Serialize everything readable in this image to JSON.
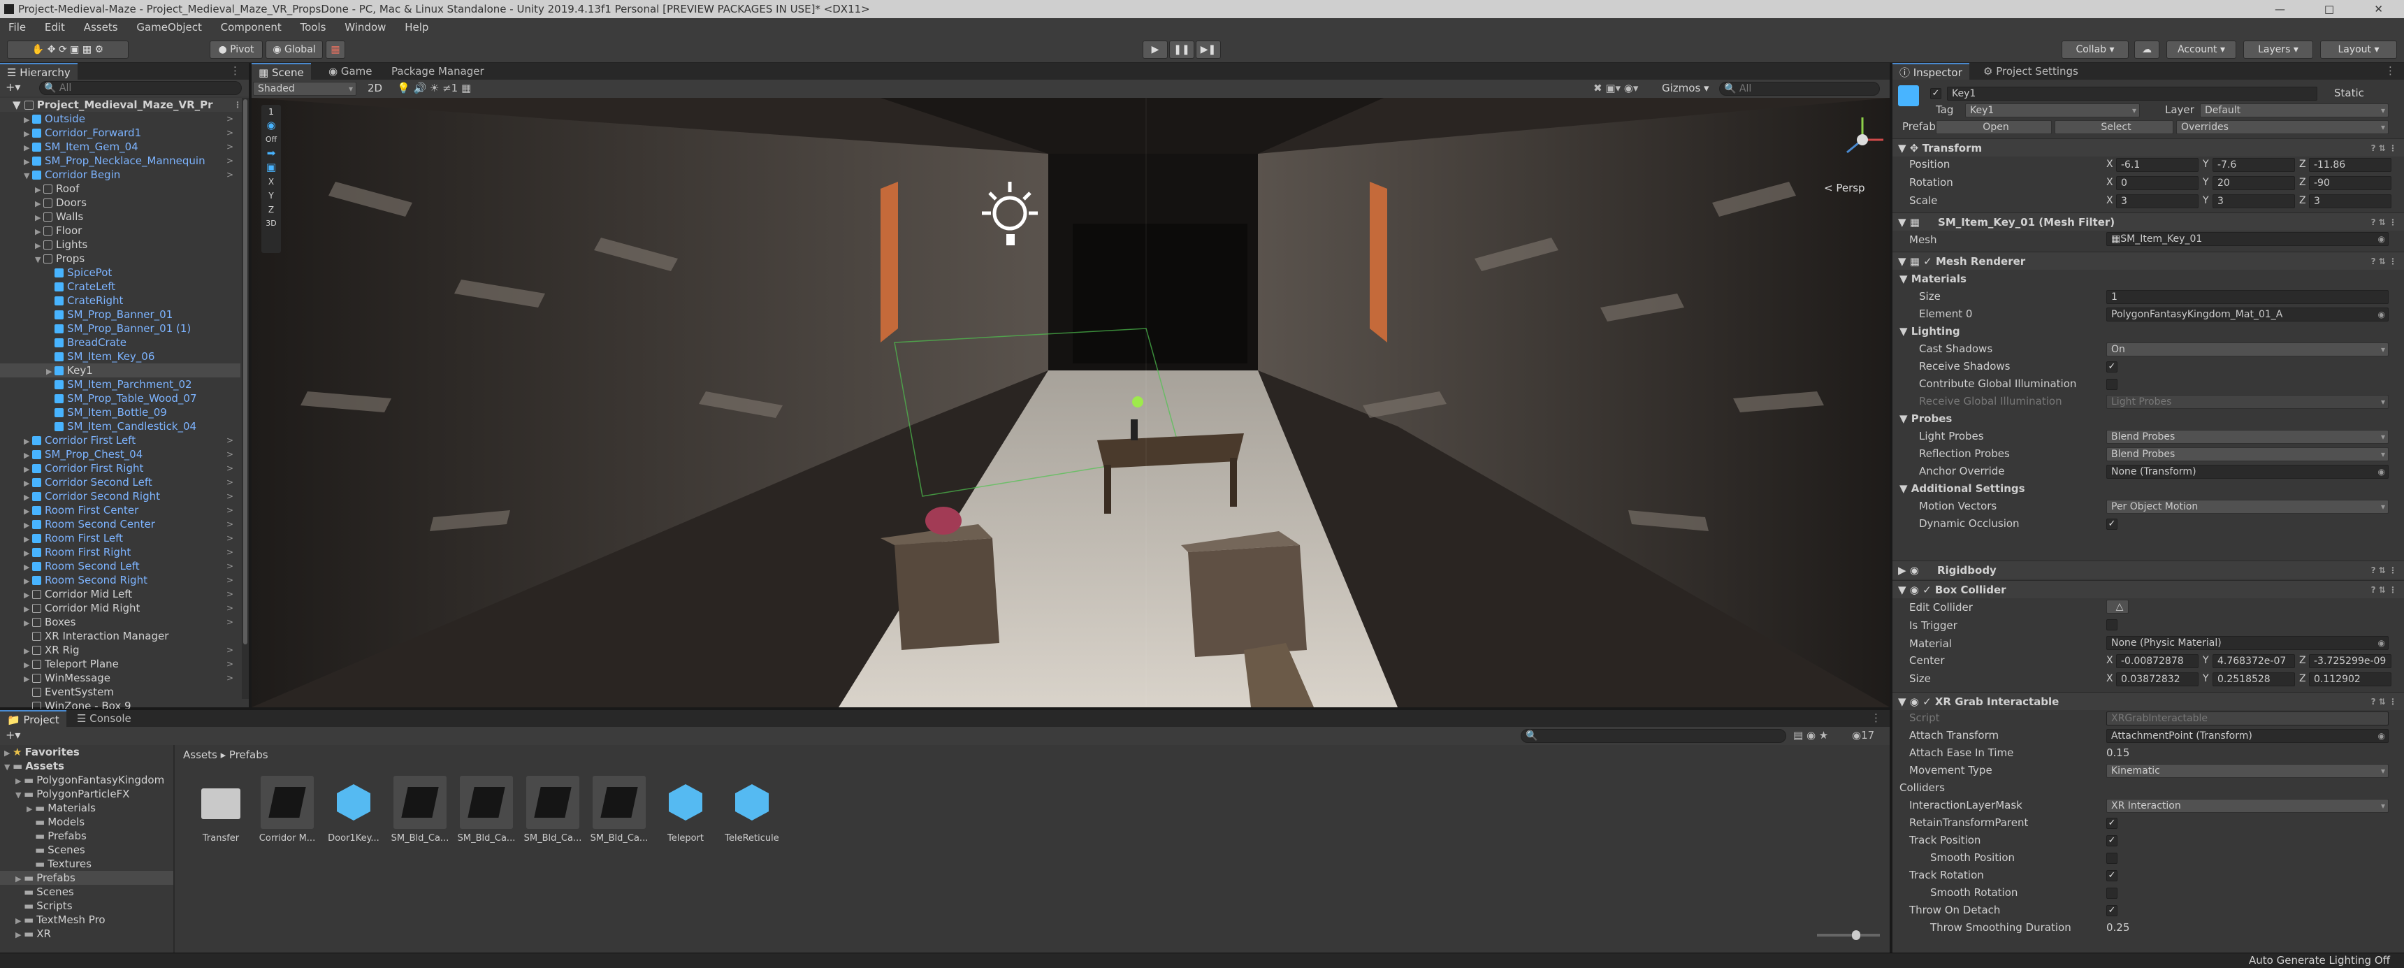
{
  "window_title": "Project-Medieval-Maze - Project_Medieval_Maze_VR_PropsDone - PC, Mac & Linux Standalone - Unity 2019.4.13f1 Personal [PREVIEW PACKAGES IN USE]* <DX11>",
  "menu": [
    "File",
    "Edit",
    "Assets",
    "GameObject",
    "Component",
    "Tools",
    "Window",
    "Help"
  ],
  "toolbar": {
    "pivot": "Pivot",
    "global": "Global",
    "collab": "Collab",
    "account": "Account",
    "layers": "Layers",
    "layout": "Layout"
  },
  "hierarchy": {
    "tab": "Hierarchy",
    "search_placeholder": "All",
    "root": "Project_Medieval_Maze_VR_Pr",
    "items": [
      {
        "label": "Outside",
        "indent": 1,
        "blue": true,
        "cube": "blue",
        "arrow": "▶",
        "sel": false
      },
      {
        "label": "Corridor_Forward1",
        "indent": 1,
        "blue": true,
        "cube": "blue",
        "arrow": "▶",
        "sel": false
      },
      {
        "label": "SM_Item_Gem_04",
        "indent": 1,
        "blue": true,
        "cube": "blue",
        "arrow": "▶",
        "sel": false
      },
      {
        "label": "SM_Prop_Necklace_Mannequin",
        "indent": 1,
        "blue": true,
        "cube": "blue",
        "arrow": "▶",
        "sel": false
      },
      {
        "label": "Corridor Begin",
        "indent": 1,
        "blue": true,
        "cube": "blue",
        "arrow": "▼",
        "sel": false
      },
      {
        "label": "Roof",
        "indent": 2,
        "blue": false,
        "cube": "grey",
        "arrow": "▶",
        "sel": false
      },
      {
        "label": "Doors",
        "indent": 2,
        "blue": false,
        "cube": "grey",
        "arrow": "▶",
        "sel": false
      },
      {
        "label": "Walls",
        "indent": 2,
        "blue": false,
        "cube": "grey",
        "arrow": "▶",
        "sel": false
      },
      {
        "label": "Floor",
        "indent": 2,
        "blue": false,
        "cube": "grey",
        "arrow": "▶",
        "sel": false
      },
      {
        "label": "Lights",
        "indent": 2,
        "blue": false,
        "cube": "grey",
        "arrow": "▶",
        "sel": false
      },
      {
        "label": "Props",
        "indent": 2,
        "blue": false,
        "cube": "grey",
        "arrow": "▼",
        "sel": false
      },
      {
        "label": "SpicePot",
        "indent": 3,
        "blue": true,
        "cube": "blue",
        "arrow": "",
        "sel": false
      },
      {
        "label": "CrateLeft",
        "indent": 3,
        "blue": true,
        "cube": "blue",
        "arrow": "",
        "sel": false
      },
      {
        "label": "CrateRight",
        "indent": 3,
        "blue": true,
        "cube": "blue",
        "arrow": "",
        "sel": false
      },
      {
        "label": "SM_Prop_Banner_01",
        "indent": 3,
        "blue": true,
        "cube": "blue",
        "arrow": "",
        "sel": false
      },
      {
        "label": "SM_Prop_Banner_01 (1)",
        "indent": 3,
        "blue": true,
        "cube": "blue",
        "arrow": "",
        "sel": false
      },
      {
        "label": "BreadCrate",
        "indent": 3,
        "blue": true,
        "cube": "blue",
        "arrow": "",
        "sel": false
      },
      {
        "label": "SM_Item_Key_06",
        "indent": 3,
        "blue": true,
        "cube": "blue",
        "arrow": "",
        "sel": false
      },
      {
        "label": "Key1",
        "indent": 3,
        "blue": false,
        "cube": "blue",
        "arrow": "▶",
        "sel": true
      },
      {
        "label": "SM_Item_Parchment_02",
        "indent": 3,
        "blue": true,
        "cube": "blue",
        "arrow": "",
        "sel": false
      },
      {
        "label": "SM_Prop_Table_Wood_07",
        "indent": 3,
        "blue": true,
        "cube": "blue",
        "arrow": "",
        "sel": false
      },
      {
        "label": "SM_Item_Bottle_09",
        "indent": 3,
        "blue": true,
        "cube": "blue",
        "arrow": "",
        "sel": false
      },
      {
        "label": "SM_Item_Candlestick_04",
        "indent": 3,
        "blue": true,
        "cube": "blue",
        "arrow": "",
        "sel": false
      },
      {
        "label": "Corridor First Left",
        "indent": 1,
        "blue": true,
        "cube": "blue",
        "arrow": "▶",
        "sel": false
      },
      {
        "label": "SM_Prop_Chest_04",
        "indent": 1,
        "blue": true,
        "cube": "blue",
        "arrow": "▶",
        "sel": false
      },
      {
        "label": "Corridor First Right",
        "indent": 1,
        "blue": true,
        "cube": "blue",
        "arrow": "▶",
        "sel": false
      },
      {
        "label": "Corridor Second Left",
        "indent": 1,
        "blue": true,
        "cube": "blue",
        "arrow": "▶",
        "sel": false
      },
      {
        "label": "Corridor Second Right",
        "indent": 1,
        "blue": true,
        "cube": "blue",
        "arrow": "▶",
        "sel": false
      },
      {
        "label": "Room First Center",
        "indent": 1,
        "blue": true,
        "cube": "blue",
        "arrow": "▶",
        "sel": false
      },
      {
        "label": "Room Second Center",
        "indent": 1,
        "blue": true,
        "cube": "blue",
        "arrow": "▶",
        "sel": false
      },
      {
        "label": "Room First Left",
        "indent": 1,
        "blue": true,
        "cube": "blue",
        "arrow": "▶",
        "sel": false
      },
      {
        "label": "Room First Right",
        "indent": 1,
        "blue": true,
        "cube": "blue",
        "arrow": "▶",
        "sel": false
      },
      {
        "label": "Room Second Left",
        "indent": 1,
        "blue": true,
        "cube": "blue",
        "arrow": "▶",
        "sel": false
      },
      {
        "label": "Room Second Right",
        "indent": 1,
        "blue": true,
        "cube": "blue",
        "arrow": "▶",
        "sel": false
      },
      {
        "label": "Corridor Mid Left",
        "indent": 1,
        "blue": false,
        "cube": "grey",
        "arrow": "▶",
        "sel": false
      },
      {
        "label": "Corridor Mid Right",
        "indent": 1,
        "blue": false,
        "cube": "grey",
        "arrow": "▶",
        "sel": false
      },
      {
        "label": "Boxes",
        "indent": 1,
        "blue": false,
        "cube": "grey",
        "arrow": "▶",
        "sel": false
      },
      {
        "label": "XR Interaction Manager",
        "indent": 1,
        "blue": false,
        "cube": "grey",
        "arrow": "",
        "sel": false
      },
      {
        "label": "XR Rig",
        "indent": 1,
        "blue": false,
        "cube": "grey",
        "arrow": "▶",
        "sel": false
      },
      {
        "label": "Teleport Plane",
        "indent": 1,
        "blue": false,
        "cube": "grey",
        "arrow": "▶",
        "sel": false
      },
      {
        "label": "WinMessage",
        "indent": 1,
        "blue": false,
        "cube": "grey",
        "arrow": "▶",
        "sel": false
      },
      {
        "label": "EventSystem",
        "indent": 1,
        "blue": false,
        "cube": "grey",
        "arrow": "",
        "sel": false
      },
      {
        "label": "WinZone - Box 9",
        "indent": 1,
        "blue": false,
        "cube": "grey",
        "arrow": "",
        "sel": false
      }
    ]
  },
  "scene": {
    "tabs": [
      "Scene",
      "Game",
      "Package Manager"
    ],
    "shading": "Shaded",
    "mode": "2D",
    "gizmos": "Gizmos",
    "search_placeholder": "All",
    "persp": "< Persp",
    "side_tools": [
      "1",
      "",
      "Off",
      "",
      "",
      "X",
      "Y",
      "Z",
      "3D"
    ]
  },
  "project": {
    "tabs": [
      "Project",
      "Console"
    ],
    "breadcrumb": [
      "Assets",
      "Prefabs"
    ],
    "count": "17",
    "tree": [
      {
        "label": "Favorites",
        "indent": 0,
        "arrow": "▶",
        "star": true
      },
      {
        "label": "Assets",
        "indent": 0,
        "arrow": "▼",
        "star": false
      },
      {
        "label": "PolygonFantasyKingdom",
        "indent": 1,
        "arrow": "▶",
        "star": false
      },
      {
        "label": "PolygonParticleFX",
        "indent": 1,
        "arrow": "▼",
        "star": false
      },
      {
        "label": "Materials",
        "indent": 2,
        "arrow": "▶",
        "star": false
      },
      {
        "label": "Models",
        "indent": 2,
        "arrow": "",
        "star": false
      },
      {
        "label": "Prefabs",
        "indent": 2,
        "arrow": "",
        "star": false
      },
      {
        "label": "Scenes",
        "indent": 2,
        "arrow": "",
        "star": false
      },
      {
        "label": "Textures",
        "indent": 2,
        "arrow": "",
        "star": false
      },
      {
        "label": "Prefabs",
        "indent": 1,
        "arrow": "▶",
        "star": false
      },
      {
        "label": "Scenes",
        "indent": 1,
        "arrow": "",
        "star": false
      },
      {
        "label": "Scripts",
        "indent": 1,
        "arrow": "",
        "star": false
      },
      {
        "label": "TextMesh Pro",
        "indent": 1,
        "arrow": "▶",
        "star": false
      },
      {
        "label": "XR",
        "indent": 1,
        "arrow": "▶",
        "star": false
      }
    ],
    "assets": [
      {
        "label": "Transfer",
        "kind": "folder"
      },
      {
        "label": "Corridor M...",
        "kind": "dark"
      },
      {
        "label": "Door1Key...",
        "kind": "cube"
      },
      {
        "label": "SM_Bld_Ca...",
        "kind": "dark"
      },
      {
        "label": "SM_Bld_Ca...",
        "kind": "dark"
      },
      {
        "label": "SM_Bld_Ca...",
        "kind": "dark"
      },
      {
        "label": "SM_Bld_Ca...",
        "kind": "dark"
      },
      {
        "label": "Teleport",
        "kind": "cube"
      },
      {
        "label": "TeleReticule",
        "kind": "cube"
      }
    ]
  },
  "inspector": {
    "tabs": [
      "Inspector",
      "Project Settings"
    ],
    "name": "Key1",
    "static": "Static",
    "tag_label": "Tag",
    "tag": "Key1",
    "layer_label": "Layer",
    "layer": "Default",
    "prefab_label": "Prefab",
    "open": "Open",
    "select": "Select",
    "overrides": "Overrides",
    "transform": {
      "title": "Transform",
      "position_label": "Position",
      "rotation_label": "Rotation",
      "scale_label": "Scale",
      "position": [
        "-6.1",
        "-7.6",
        "-11.86"
      ],
      "rotation": [
        "0",
        "20",
        "-90"
      ],
      "scale": [
        "3",
        "3",
        "3"
      ]
    },
    "mesh_filter": {
      "title": "SM_Item_Key_01 (Mesh Filter)",
      "mesh_label": "Mesh",
      "mesh": "SM_Item_Key_01"
    },
    "mesh_renderer": {
      "title": "Mesh Renderer",
      "materials": "Materials",
      "size_label": "Size",
      "size": "1",
      "element0_label": "Element 0",
      "element0": "PolygonFantasyKingdom_Mat_01_A",
      "lighting": "Lighting",
      "cast_shadows_label": "Cast Shadows",
      "cast_shadows": "On",
      "receive_shadows": "Receive Shadows",
      "contribute_gi": "Contribute Global Illumination",
      "receive_gi_label": "Receive Global Illumination",
      "receive_gi": "Light Probes",
      "probes": "Probes",
      "light_probes_label": "Light Probes",
      "light_probes": "Blend Probes",
      "reflection_probes_label": "Reflection Probes",
      "reflection_probes": "Blend Probes",
      "anchor_override_label": "Anchor Override",
      "anchor_override": "None (Transform)",
      "additional": "Additional Settings",
      "motion_vectors_label": "Motion Vectors",
      "motion_vectors": "Per Object Motion",
      "dynamic_occlusion": "Dynamic Occlusion"
    },
    "rigidbody": {
      "title": "Rigidbody"
    },
    "box_collider": {
      "title": "Box Collider",
      "edit_collider": "Edit Collider",
      "is_trigger": "Is Trigger",
      "material_label": "Material",
      "material": "None (Physic Material)",
      "center_label": "Center",
      "size_label": "Size",
      "center": [
        "-0.00872878",
        "4.768372e-07",
        "-3.725299e-09"
      ],
      "size": [
        "0.03872832",
        "0.2518528",
        "0.112902"
      ]
    },
    "xr_grab": {
      "title": "XR Grab Interactable",
      "script_label": "Script",
      "script": "XRGrabInteractable",
      "attach_transform_label": "Attach Transform",
      "attach_transform": "AttachmentPoint (Transform)",
      "attach_ease_label": "Attach Ease In Time",
      "attach_ease": "0.15",
      "movement_type_label": "Movement Type",
      "movement_type": "Kinematic",
      "colliders": "Colliders",
      "interaction_mask_label": "InteractionLayerMask",
      "interaction_mask": "XR Interaction",
      "retain_parent": "RetainTransformParent",
      "track_position": "Track Position",
      "smooth_position": "Smooth Position",
      "track_rotation": "Track Rotation",
      "smooth_rotation": "Smooth Rotation",
      "throw_on_detach": "Throw On Detach",
      "throw_smoothing_label": "Throw Smoothing Duration",
      "throw_smoothing": "0.25"
    }
  },
  "status": "Auto Generate Lighting Off"
}
